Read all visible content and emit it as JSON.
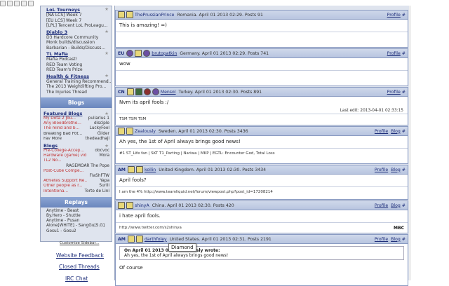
{
  "browser": {
    "tab_icons": [
      "tab-icon-1",
      "tab-icon-2",
      "tab-icon-3",
      "tab-icon-4",
      "tab-icon-5"
    ]
  },
  "sidebar": {
    "tourneys": {
      "title": "LoL Tourneys",
      "items": [
        "[NA LCS] Week 7",
        "[EU LCS] Week 7",
        "[LPL] Tencent LoL ProLeagu..."
      ]
    },
    "diablo": {
      "title": "Diablo 3",
      "items": [
        "D3 Hardcore Community",
        "Monk builds/discussion",
        "Barbarian - Builds/Discuss..."
      ]
    },
    "mafia": {
      "title": "TL Mafia",
      "items": [
        "Mafia Podcast!",
        "RED Team Voting",
        "RED Team's Prize"
      ]
    },
    "health": {
      "title": "Health & Fitness",
      "items": [
        "General Training Recommend...",
        "The 2013 Weightlifting Pro...",
        "The Injuries Thread"
      ]
    },
    "blogs_header": "Blogs",
    "featured": {
      "title": "Featured Blogs",
      "rows": [
        {
          "l": "My Dota 2 Jou...",
          "r": "puliarius 1"
        },
        {
          "l": "Any Bloodbrothe...",
          "r": "disciple"
        },
        {
          "l": "The mind and b...",
          "r": "LuckyFool"
        },
        {
          "l": "Breaking Bad Pot...",
          "r": "Gilder"
        },
        {
          "l": "Fav More",
          "r": "thedeadhaji"
        }
      ]
    },
    "blogs": {
      "title": "Blogs",
      "rows": [
        {
          "l": "Pre-College-Accep...",
          "r": "docvoc"
        },
        {
          "l": "Hardware (game) vid...",
          "r": "Mora"
        },
        {
          "l": "TL2 No...",
          "r": ""
        },
        {
          "l": "",
          "r": "RAGEMOAR The Pope"
        },
        {
          "l": "Post-Cube Compe...",
          "r": ""
        },
        {
          "l": "",
          "r": "FlaShFTW"
        },
        {
          "l": "Athletes Support Ne...",
          "r": "Yapa"
        },
        {
          "l": "Other people as r...",
          "r": "Surili"
        },
        {
          "l": "Intentiona...",
          "r": "Torte de Lini"
        }
      ]
    },
    "replays_header": "Replays",
    "replays": [
      "Anytime - Beast",
      "By.Hero - Shuttle",
      "Anytime - Pusan",
      "Alone[WHITE] - SangGu[S.G]",
      "Gosu1 - Gosu2"
    ],
    "customize": "Customize Sidebar...",
    "website_feedback": "Website Feedback",
    "closed_threads": "Closed Threads",
    "irc_chat": "IRC Chat"
  },
  "posts": [
    {
      "lang": "",
      "user": "ThePrussianPrince",
      "meta": "Romania. April 01 2013 02:29. Posts 91",
      "body": "This is amazing! =)",
      "sig": "",
      "profile": "Profile"
    },
    {
      "lang": "EU",
      "user": "brutopatkin",
      "meta": "Germany. April 01 2013 02:29. Posts 741",
      "body": "wow",
      "sig": "",
      "profile": "Profile"
    },
    {
      "lang": "CN",
      "user": "Mensol",
      "meta": "Turkey. April 01 2013 02:30. Posts 891",
      "body": "Nvm its april fools :/",
      "edit": "Last edit: 2013-04-01 02:33:15",
      "sig": "TSM TSM TSM",
      "profile": "Profile"
    },
    {
      "lang": "",
      "user": "Zealously",
      "meta": "Sweden. April 01 2013 02:30. Posts 3436",
      "body": "Ah yes, the 1st of April always brings good news!",
      "sig": "#1 ST_Life fan | SKT T1_Parting | Nariwa | MKP | EGTL: Encounter God, Total Loss",
      "profile": "Profile",
      "blog": "Blog"
    },
    {
      "lang": "AM",
      "user": "kollin",
      "meta": "United Kingdom. April 01 2013 02:30. Posts 3434",
      "body": "April fools?",
      "sig": "I am the 4% http://www.teamliquid.net/forum/viewpost.php?post_id=17208214",
      "profile": "Profile",
      "blog": "Blog"
    },
    {
      "lang": "",
      "user": "shinyA",
      "meta": "China. April 01 2013 02:30. Posts 420",
      "body": "i hate april fools.",
      "sig": "http://www.twitter.com/s2shinya",
      "sig_logo": "MBC",
      "profile": "Profile",
      "blog": "Blog"
    },
    {
      "lang": "AM",
      "user": "darthfoley",
      "meta": "United States. April 01 2013 02:31. Posts 2191",
      "quote_by": "On April 01 2013 02:30 Zealously wrote:",
      "quote": "Ah yes, the 1st of April always brings good news!",
      "body": "Of course",
      "profile": "Profile",
      "blog": "Blog"
    }
  ],
  "tooltip": "Diamond",
  "colors": {
    "header_bg": "#b8c5e0",
    "sidebar_bg": "#dfe4ee",
    "link": "#1f2f7a",
    "blog_red": "#c03030"
  }
}
